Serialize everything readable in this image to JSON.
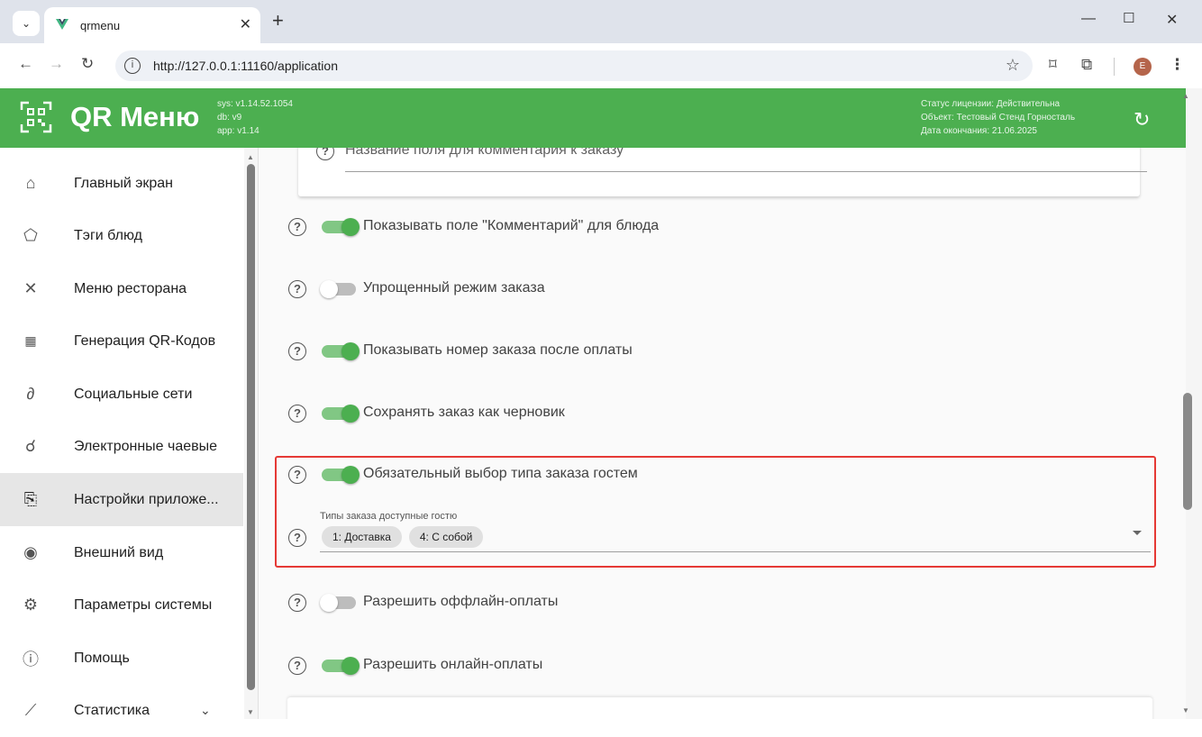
{
  "browser": {
    "tab_title": "qrmenu",
    "url": "http://127.0.0.1:11160/application",
    "profile_initial": "E"
  },
  "app": {
    "brand": "QR Меню",
    "versions": [
      "sys: v1.14.52.1054",
      "db: v9",
      "app: v1.14"
    ],
    "license": [
      "Статус лицензии: Действительна",
      "Объект: Тестовый Стенд Горносталь",
      "Дата окончания: 21.06.2025"
    ],
    "brand_color": "#4caf50"
  },
  "sidebar": {
    "items": [
      {
        "label": "Главный экран",
        "icon": "home-icon"
      },
      {
        "label": "Тэги блюд",
        "icon": "tag-icon"
      },
      {
        "label": "Меню ресторана",
        "icon": "cutlery-icon"
      },
      {
        "label": "Генерация QR-Кодов",
        "icon": "qr-code-icon"
      },
      {
        "label": "Социальные сети",
        "icon": "link-icon"
      },
      {
        "label": "Электронные чаевые",
        "icon": "tips-hand-icon"
      },
      {
        "label": "Настройки приложе...",
        "icon": "app-settings-icon",
        "active": true
      },
      {
        "label": "Внешний вид",
        "icon": "eye-icon"
      },
      {
        "label": "Параметры системы",
        "icon": "gear-icon"
      },
      {
        "label": "Помощь",
        "icon": "help-icon"
      },
      {
        "label": "Статистика",
        "icon": "chart-icon"
      }
    ]
  },
  "main": {
    "comment_field_label": "Название поля для комментария к заказу",
    "settings": [
      {
        "label": "Показывать поле \"Комментарий\" для блюда",
        "on": true
      },
      {
        "label": "Упрощенный режим заказа",
        "on": false
      },
      {
        "label": "Показывать номер заказа после оплаты",
        "on": true
      },
      {
        "label": "Сохранять заказ как черновик",
        "on": true
      },
      {
        "label": "Обязательный выбор типа заказа гостем",
        "on": true
      },
      {
        "label": "Разрешить оффлайн-оплаты",
        "on": false
      },
      {
        "label": "Разрешить онлайн-оплаты",
        "on": true
      }
    ],
    "order_types": {
      "label": "Типы заказа доступные гостю",
      "chips": [
        "1: Доставка",
        "4: С собой"
      ]
    }
  }
}
